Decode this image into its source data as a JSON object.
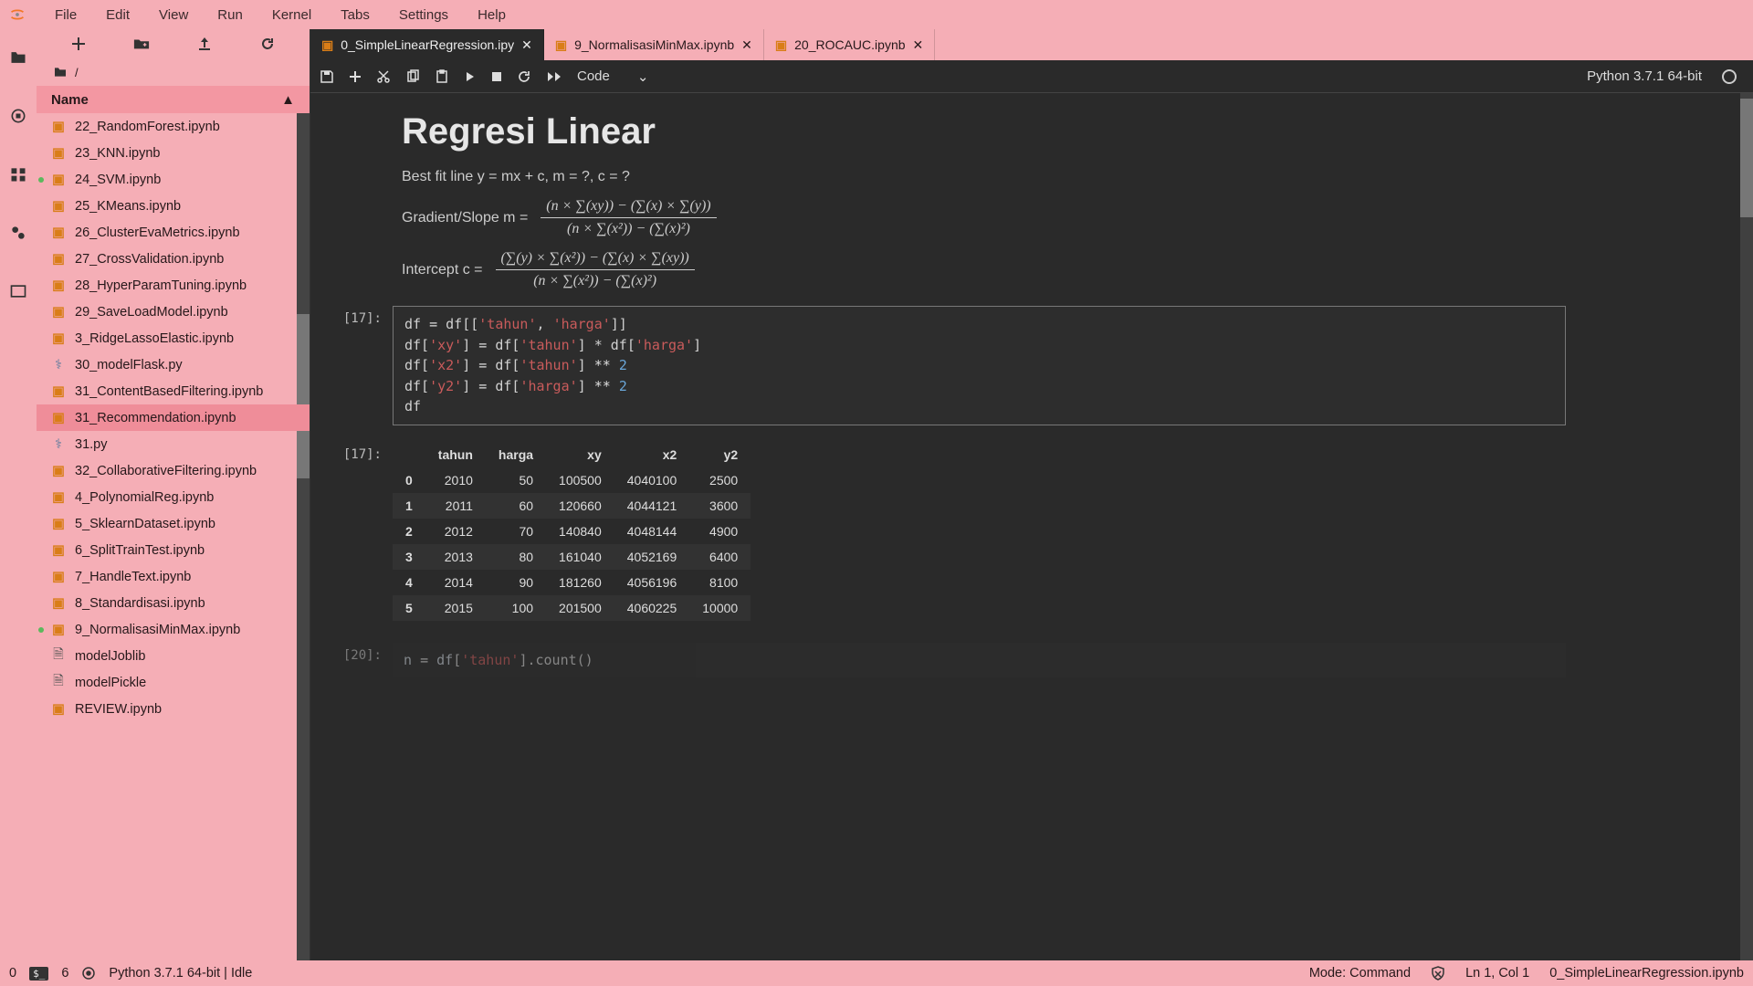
{
  "menu": {
    "items": [
      "File",
      "Edit",
      "View",
      "Run",
      "Kernel",
      "Tabs",
      "Settings",
      "Help"
    ]
  },
  "breadcrumb": "/",
  "sidebar_header": "Name",
  "files": [
    {
      "name": "22_RandomForest.ipynb",
      "icon": "nb",
      "running": false,
      "selected": false
    },
    {
      "name": "23_KNN.ipynb",
      "icon": "nb",
      "running": false,
      "selected": false
    },
    {
      "name": "24_SVM.ipynb",
      "icon": "nb",
      "running": true,
      "selected": false
    },
    {
      "name": "25_KMeans.ipynb",
      "icon": "nb",
      "running": false,
      "selected": false
    },
    {
      "name": "26_ClusterEvaMetrics.ipynb",
      "icon": "nb",
      "running": false,
      "selected": false
    },
    {
      "name": "27_CrossValidation.ipynb",
      "icon": "nb",
      "running": false,
      "selected": false
    },
    {
      "name": "28_HyperParamTuning.ipynb",
      "icon": "nb",
      "running": false,
      "selected": false
    },
    {
      "name": "29_SaveLoadModel.ipynb",
      "icon": "nb",
      "running": false,
      "selected": false
    },
    {
      "name": "3_RidgeLassoElastic.ipynb",
      "icon": "nb",
      "running": false,
      "selected": false
    },
    {
      "name": "30_modelFlask.py",
      "icon": "py",
      "running": false,
      "selected": false
    },
    {
      "name": "31_ContentBasedFiltering.ipynb",
      "icon": "nb",
      "running": false,
      "selected": false
    },
    {
      "name": "31_Recommendation.ipynb",
      "icon": "nb",
      "running": false,
      "selected": true
    },
    {
      "name": "31.py",
      "icon": "py",
      "running": false,
      "selected": false
    },
    {
      "name": "32_CollaborativeFiltering.ipynb",
      "icon": "nb",
      "running": false,
      "selected": false
    },
    {
      "name": "4_PolynomialReg.ipynb",
      "icon": "nb",
      "running": false,
      "selected": false
    },
    {
      "name": "5_SklearnDataset.ipynb",
      "icon": "nb",
      "running": false,
      "selected": false
    },
    {
      "name": "6_SplitTrainTest.ipynb",
      "icon": "nb",
      "running": false,
      "selected": false
    },
    {
      "name": "7_HandleText.ipynb",
      "icon": "nb",
      "running": false,
      "selected": false
    },
    {
      "name": "8_Standardisasi.ipynb",
      "icon": "nb",
      "running": false,
      "selected": false
    },
    {
      "name": "9_NormalisasiMinMax.ipynb",
      "icon": "nb",
      "running": true,
      "selected": false
    },
    {
      "name": "modelJoblib",
      "icon": "doc",
      "running": false,
      "selected": false
    },
    {
      "name": "modelPickle",
      "icon": "doc",
      "running": false,
      "selected": false
    },
    {
      "name": "REVIEW.ipynb",
      "icon": "nb",
      "running": false,
      "selected": false
    }
  ],
  "tabs": [
    {
      "label": "0_SimpleLinearRegression.ipy",
      "active": true
    },
    {
      "label": "9_NormalisasiMinMax.ipynb",
      "active": false
    },
    {
      "label": "20_ROCAUC.ipynb",
      "active": false
    }
  ],
  "nb_toolbar": {
    "cell_type": "Code"
  },
  "kernel_name": "Python 3.7.1 64-bit",
  "markdown": {
    "heading": "Regresi Linear",
    "best_fit": "Best fit line y = mx + c, m = ?, c = ?",
    "gradient_label": "Gradient/Slope m =",
    "intercept_label": "Intercept c =",
    "grad_num": "(n × ∑(xy)) − (∑(x) × ∑(y))",
    "grad_den": "(n × ∑(x²)) − (∑(x)²)",
    "int_num": "(∑(y) × ∑(x²)) − (∑(x) × ∑(xy))",
    "int_den": "(n × ∑(x²)) − (∑(x)²)"
  },
  "code_cell": {
    "prompt": "[17]:",
    "lines": [
      "df = df[['tahun', 'harga']]",
      "df['xy'] = df['tahun'] * df['harga']",
      "df['x2'] = df['tahun'] ** 2",
      "df['y2'] = df['harga'] ** 2",
      "df"
    ]
  },
  "output": {
    "prompt": "[17]:",
    "columns": [
      "",
      "tahun",
      "harga",
      "xy",
      "x2",
      "y2"
    ],
    "rows": [
      [
        "0",
        "2010",
        "50",
        "100500",
        "4040100",
        "2500"
      ],
      [
        "1",
        "2011",
        "60",
        "120660",
        "4044121",
        "3600"
      ],
      [
        "2",
        "2012",
        "70",
        "140840",
        "4048144",
        "4900"
      ],
      [
        "3",
        "2013",
        "80",
        "161040",
        "4052169",
        "6400"
      ],
      [
        "4",
        "2014",
        "90",
        "181260",
        "4056196",
        "8100"
      ],
      [
        "5",
        "2015",
        "100",
        "201500",
        "4060225",
        "10000"
      ]
    ]
  },
  "next_cell": {
    "prompt": "[20]:",
    "partial": "n = df['tahun'].count()"
  },
  "status": {
    "left_zero": "0",
    "left_six": "6",
    "kernel": "Python 3.7.1 64-bit | Idle",
    "mode": "Mode: Command",
    "cursor": "Ln 1, Col 1",
    "file": "0_SimpleLinearRegression.ipynb"
  }
}
